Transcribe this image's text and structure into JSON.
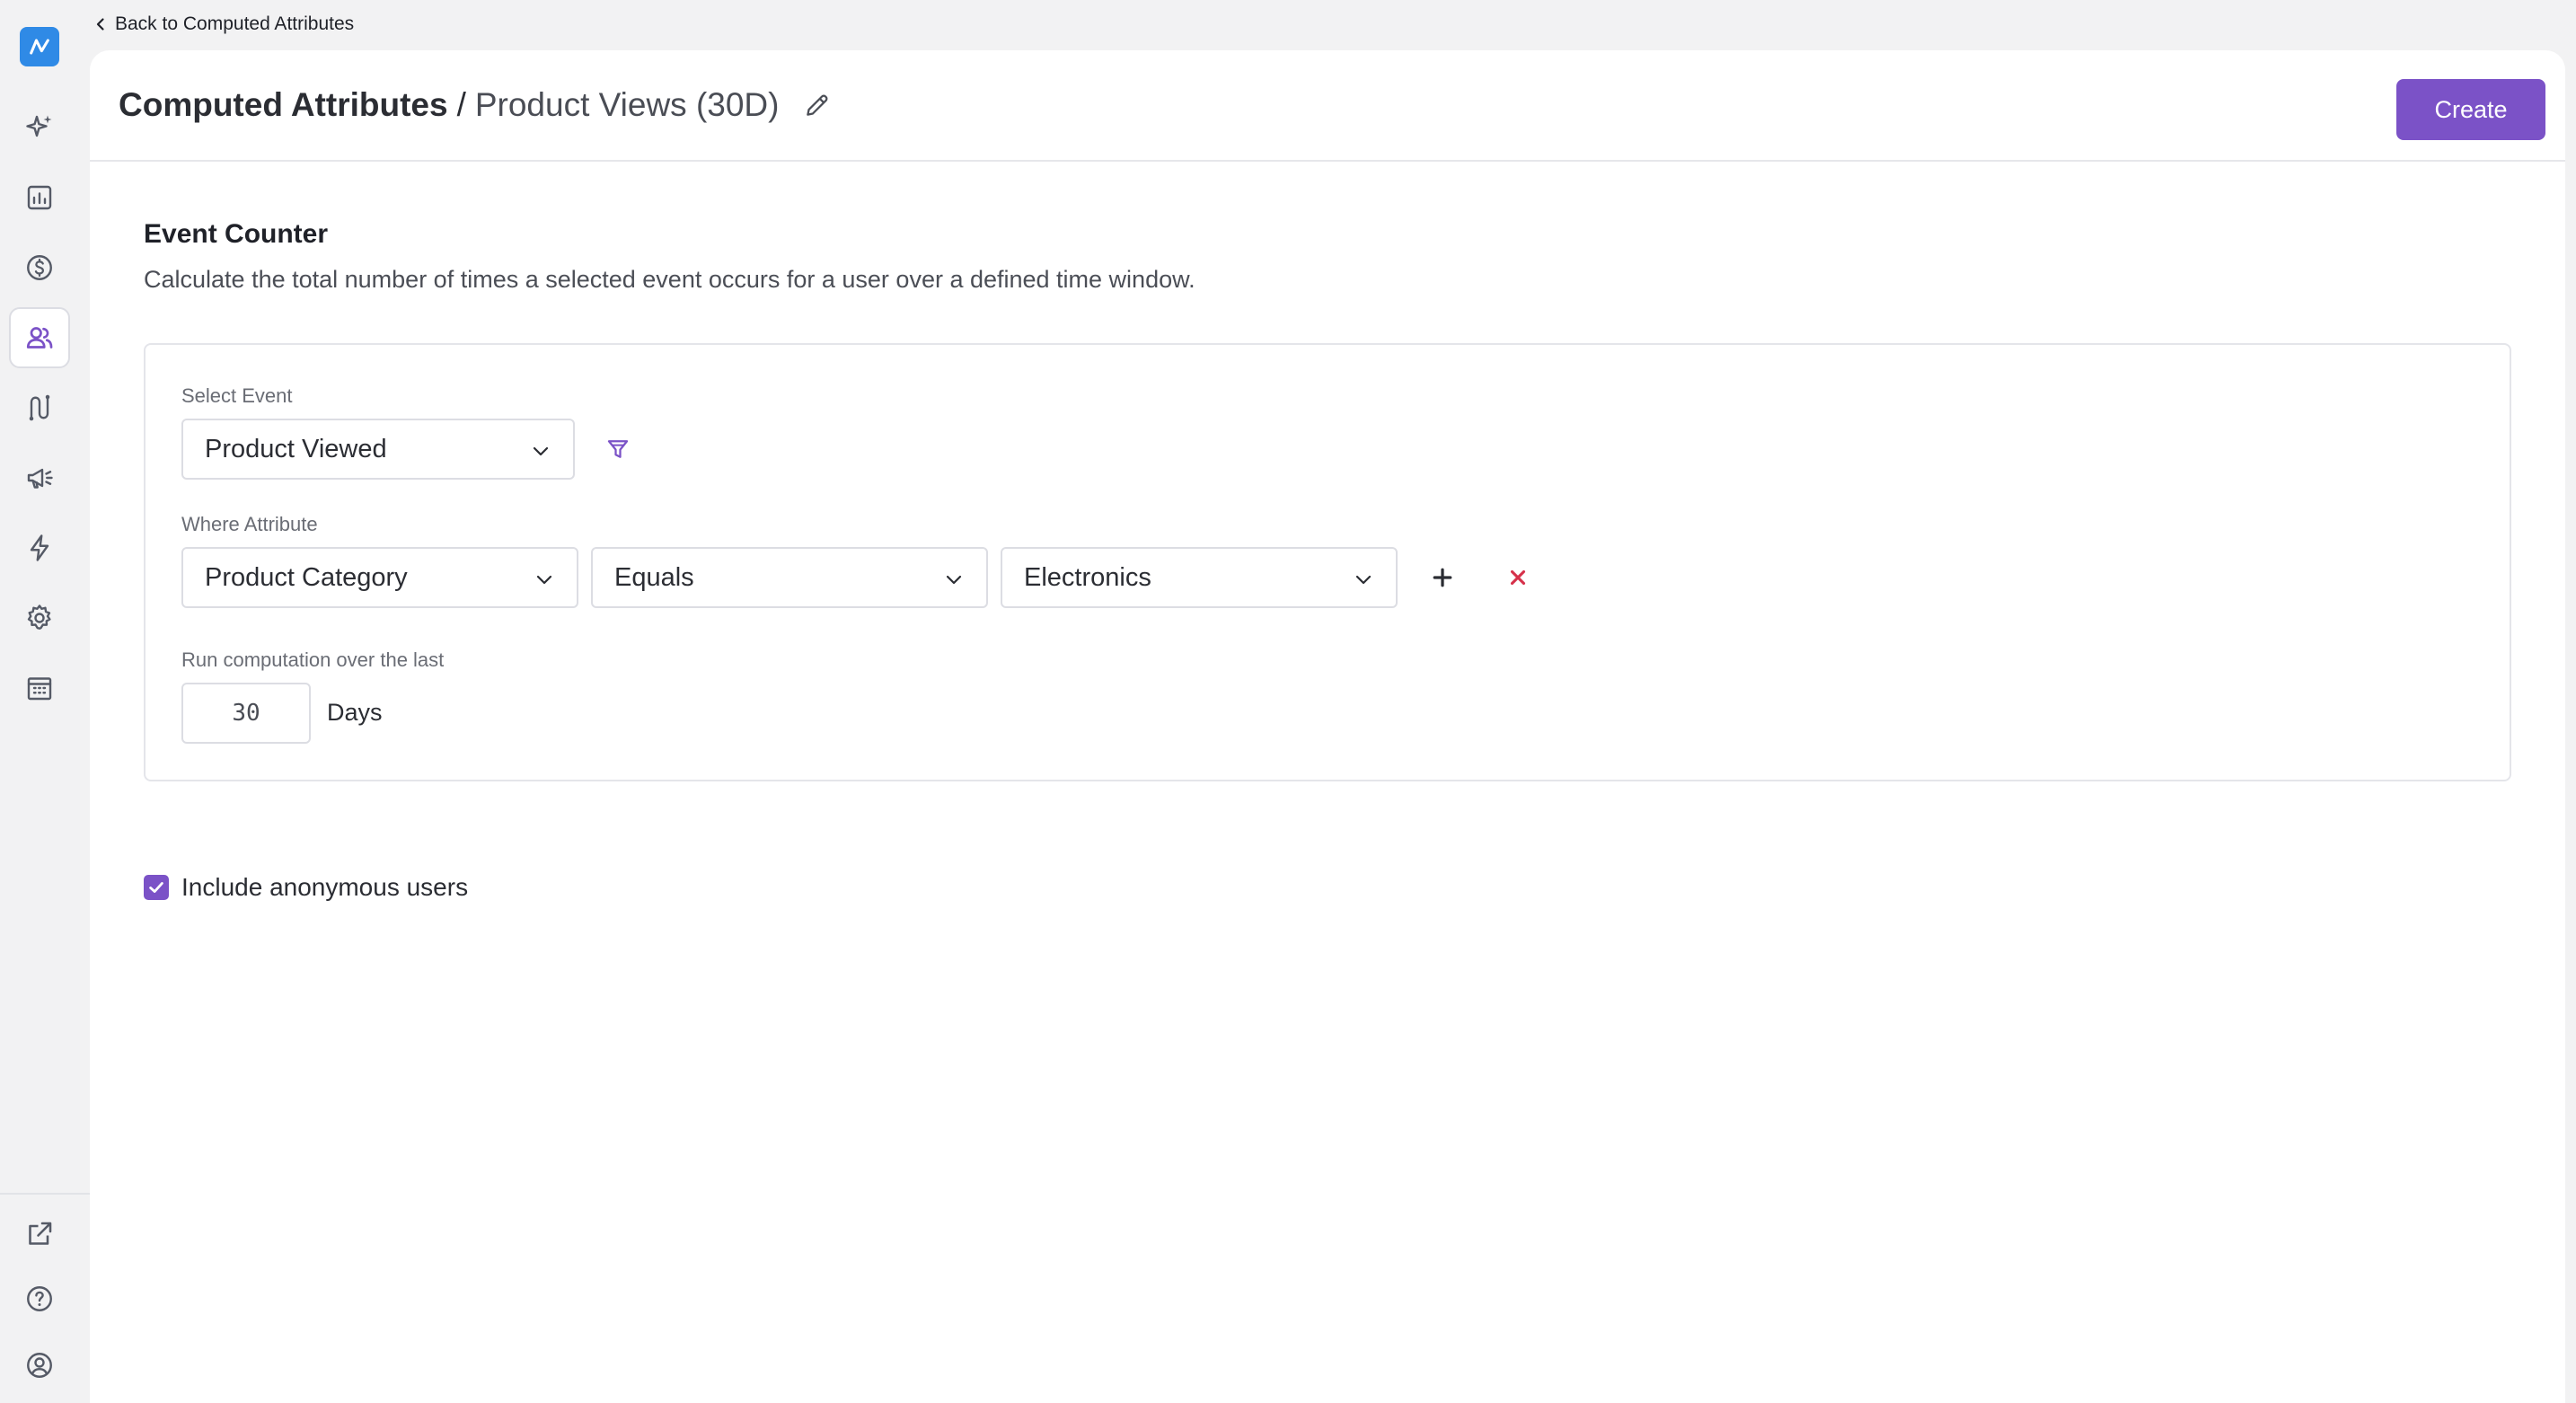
{
  "nav": {
    "back_label": "Back to Computed Attributes",
    "items": [
      {
        "name": "sparkle-icon",
        "active": false
      },
      {
        "name": "reports-icon",
        "active": false
      },
      {
        "name": "dollar-icon",
        "active": false
      },
      {
        "name": "users-icon",
        "active": true
      },
      {
        "name": "journeys-icon",
        "active": false
      },
      {
        "name": "megaphone-icon",
        "active": false
      },
      {
        "name": "lightning-icon",
        "active": false
      },
      {
        "name": "gear-icon",
        "active": false
      },
      {
        "name": "building-icon",
        "active": false
      }
    ],
    "bottom_items": [
      "external-link-icon",
      "help-icon",
      "profile-icon"
    ]
  },
  "header": {
    "title": "Computed Attributes",
    "separator": "/",
    "subtitle": "Product Views (30D)",
    "create_label": "Create"
  },
  "section": {
    "title": "Event Counter",
    "description": "Calculate the total number of times a selected event occurs for a user over a defined time window."
  },
  "form": {
    "select_event_label": "Select Event",
    "selected_event": "Product Viewed",
    "where_attribute_label": "Where Attribute",
    "attribute": "Product Category",
    "operator": "Equals",
    "value": "Electronics",
    "run_label": "Run computation over the last",
    "days_value": "30",
    "days_unit": "Days"
  },
  "options": {
    "include_anonymous_label": "Include anonymous users",
    "include_anonymous_checked": true
  },
  "colors": {
    "accent": "#7b52c7",
    "logo": "#2f8ae6",
    "remove": "#d6314a"
  }
}
